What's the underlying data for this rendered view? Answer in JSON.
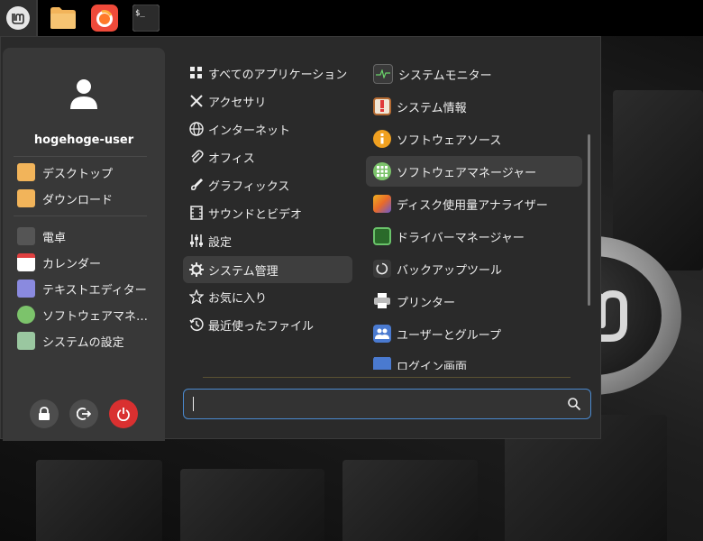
{
  "user": {
    "name": "hogehoge-user"
  },
  "favorites": [
    {
      "label": "デスクトップ",
      "color": "#f2b45a"
    },
    {
      "label": "ダウンロード",
      "color": "#f2b45a"
    },
    {
      "label": "電卓",
      "color": "#555555"
    },
    {
      "label": "カレンダー",
      "color": "#ffffff"
    },
    {
      "label": "テキストエディター",
      "color": "#8a8adf"
    },
    {
      "label": "ソフトウェアマネ…",
      "color": "#7cc36b"
    },
    {
      "label": "システムの設定",
      "color": "#9ac7a0"
    }
  ],
  "categories": [
    {
      "label": "すべてのアプリケーション",
      "icon": "grid-icon"
    },
    {
      "label": "アクセサリ",
      "icon": "tools-icon"
    },
    {
      "label": "インターネット",
      "icon": "globe-icon"
    },
    {
      "label": "オフィス",
      "icon": "paperclip-icon"
    },
    {
      "label": "グラフィックス",
      "icon": "brush-icon"
    },
    {
      "label": "サウンドとビデオ",
      "icon": "film-icon"
    },
    {
      "label": "設定",
      "icon": "sliders-icon"
    },
    {
      "label": "システム管理",
      "icon": "gear-icon"
    },
    {
      "label": "お気に入り",
      "icon": "star-icon"
    },
    {
      "label": "最近使ったファイル",
      "icon": "history-icon"
    }
  ],
  "apps": [
    {
      "label": "システムモニター",
      "color": "#3a3a3a"
    },
    {
      "label": "システム情報",
      "color": "#e05a4a"
    },
    {
      "label": "ソフトウェアソース",
      "color": "#f0a020"
    },
    {
      "label": "ソフトウェアマネージャー",
      "color": "#7cc36b"
    },
    {
      "label": "ディスク使用量アナライザー",
      "color": "#e86a2a"
    },
    {
      "label": "ドライバーマネージャー",
      "color": "#3a8a3a"
    },
    {
      "label": "バックアップツール",
      "color": "#3a3a3a"
    },
    {
      "label": "プリンター",
      "color": "#dddddd"
    },
    {
      "label": "ユーザーとグループ",
      "color": "#4a7ad0"
    },
    {
      "label": "ログイン画面",
      "color": "#4a7ad0"
    }
  ],
  "search": {
    "value": "",
    "placeholder": ""
  },
  "colors": {
    "accent": "#4a8ad0",
    "power": "#d93030"
  }
}
